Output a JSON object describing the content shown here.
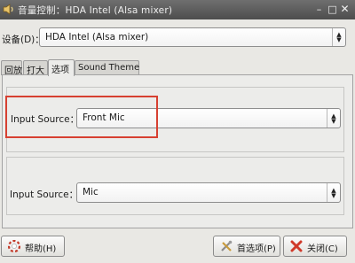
{
  "window": {
    "title": "音量控制：HDA Intel (Alsa mixer)"
  },
  "device": {
    "label": "设备(D)：",
    "value": "HDA Intel (Alsa mixer)"
  },
  "tabs": [
    {
      "label": "回放"
    },
    {
      "label": "打大"
    },
    {
      "label": "选项"
    },
    {
      "label": "Sound Theme"
    }
  ],
  "options": {
    "input_source_1": {
      "label": "Input Source：",
      "value": "Front Mic"
    },
    "input_source_2": {
      "label": "Input Source：",
      "value": "Mic"
    }
  },
  "buttons": {
    "help": "帮助(H)",
    "preferences": "首选项(P)",
    "close": "关闭(C)"
  },
  "colors": {
    "highlight": "#d74031",
    "titlebar": "#5a5a5a"
  }
}
